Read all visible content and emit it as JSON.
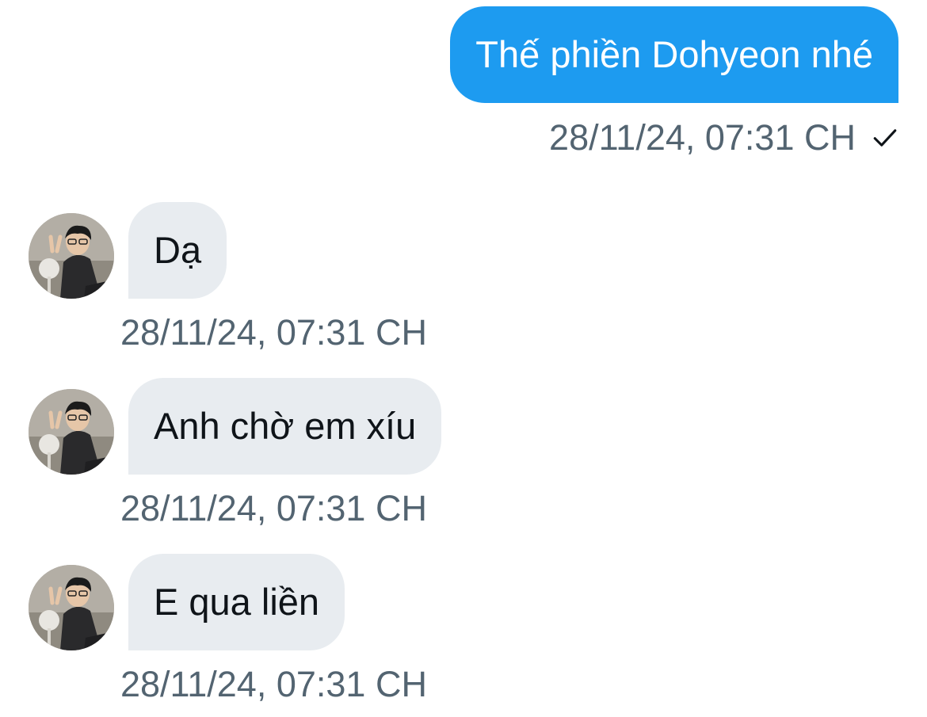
{
  "colors": {
    "sent_bubble": "#1d9bf0",
    "received_bubble": "#e8ecf0",
    "timestamp": "#536471",
    "text_dark": "#0f1419"
  },
  "conversation": {
    "sent": {
      "text": "Thế phiền Dohyeon nhé",
      "timestamp": "28/11/24, 07:31 CH",
      "status_icon": "check-icon"
    },
    "received": [
      {
        "text": "Dạ",
        "timestamp": "28/11/24, 07:31 CH",
        "avatar_icon": "avatar"
      },
      {
        "text": "Anh chờ em xíu",
        "timestamp": "28/11/24, 07:31 CH",
        "avatar_icon": "avatar"
      },
      {
        "text": "E qua liền",
        "timestamp": "28/11/24, 07:31 CH",
        "avatar_icon": "avatar"
      }
    ]
  }
}
